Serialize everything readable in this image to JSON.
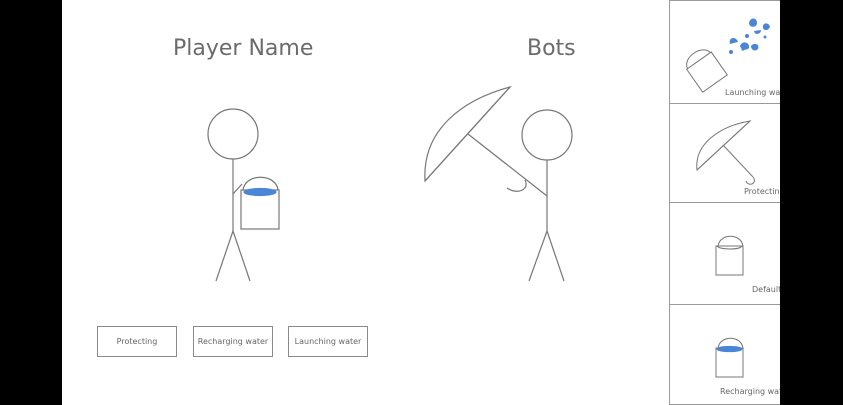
{
  "header": {
    "player_title": "Player Name",
    "bots_title": "Bots"
  },
  "actions": {
    "protecting": "Protecting",
    "recharging": "Recharging water",
    "launching": "Launching water"
  },
  "sidebar": {
    "panels": [
      {
        "label": "Launching water",
        "icon": "bucket-splash-icon"
      },
      {
        "label": "Protecting",
        "icon": "umbrella-icon"
      },
      {
        "label": "Default",
        "icon": "empty-bucket-icon"
      },
      {
        "label": "Recharging water",
        "icon": "full-bucket-icon"
      }
    ]
  },
  "colors": {
    "water": "#4a86d8",
    "stroke": "#777777"
  }
}
